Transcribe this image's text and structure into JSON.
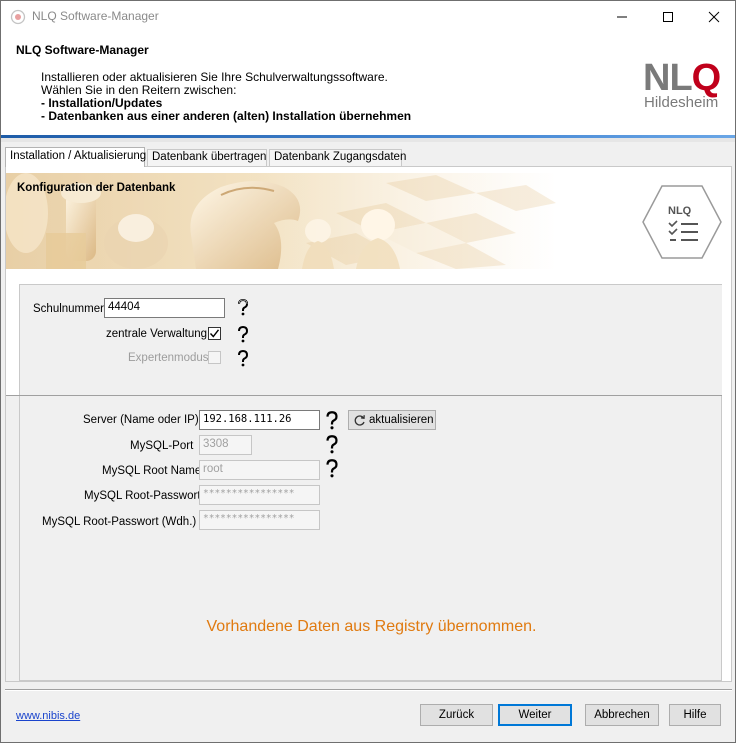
{
  "window": {
    "title": "NLQ Software-Manager"
  },
  "header": {
    "title": "NLQ Software-Manager",
    "line1": "Installieren oder aktualisieren Sie Ihre Schulverwaltungssoftware.",
    "line2": "Wählen Sie in den Reitern zwischen:",
    "line3": "- Installation/Updates",
    "line4": "- Datenbanken aus einer anderen (alten) Installation übernehmen",
    "logo_main_a": "NL",
    "logo_main_b": "Q",
    "logo_sub": "Hildesheim",
    "logo_icon_text": "NLQ"
  },
  "tabs": [
    {
      "label": "Installation / Aktualisierung",
      "active": true
    },
    {
      "label": "Datenbank übertragen",
      "active": false
    },
    {
      "label": "Datenbank Zugangsdaten",
      "active": false
    }
  ],
  "banner": {
    "title": "Konfiguration der Datenbank"
  },
  "school": {
    "schulnummer_label": "Schulnummer",
    "schulnummer_value": "44404",
    "zentrale_label": "zentrale Verwaltung",
    "zentrale_checked": true,
    "experten_label": "Expertenmodus",
    "experten_checked": false
  },
  "server": {
    "server_label": "Server (Name oder IP)",
    "server_value": "192.168.111.26",
    "refresh_label": "aktualisieren",
    "port_label": "MySQL-Port",
    "port_value": "3308",
    "rootname_label": "MySQL Root Name",
    "rootname_value": "root",
    "rootpw_label": "MySQL Root-Passwort",
    "rootpw_value": "****************",
    "rootpw2_label": "MySQL Root-Passwort (Wdh.)",
    "rootpw2_value": "****************"
  },
  "status": {
    "message": "Vorhandene Daten aus Registry übernommen.",
    "color": "#e07a10"
  },
  "footer": {
    "link": "www.nibis.de",
    "back_label": "Zurück",
    "next_label": "Weiter",
    "cancel_label": "Abbrechen",
    "help_label": "Hilfe"
  }
}
